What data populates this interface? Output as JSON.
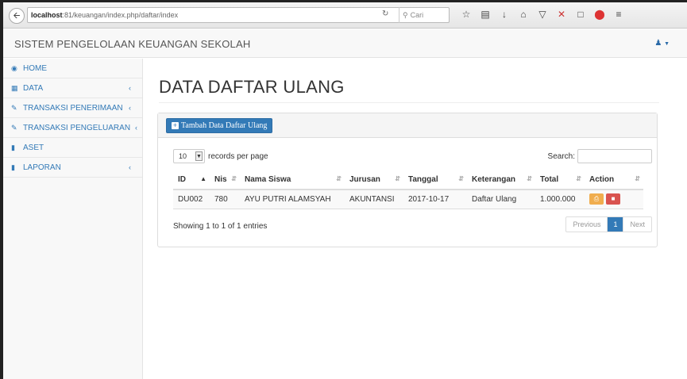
{
  "browser": {
    "url_host": "localhost",
    "url_rest": ":81/keuangan/index.php/daftar/index",
    "search_placeholder": "Cari",
    "reload_icon": "reload-icon",
    "icons": [
      "star-icon",
      "library-icon",
      "download-icon",
      "home-icon",
      "pocket-icon",
      "x-icon",
      "extension-icon",
      "adblock-icon",
      "menu-icon"
    ]
  },
  "header": {
    "title": "SISTEM PENGELOLAAN KEUANGAN SEKOLAH",
    "user_icon": "user-icon"
  },
  "sidebar": {
    "items": [
      {
        "label": "HOME",
        "icon": "dashboard-icon",
        "has_arrow": false
      },
      {
        "label": "DATA",
        "icon": "table-icon",
        "has_arrow": true
      },
      {
        "label": "TRANSAKSI PENERIMAAN",
        "icon": "edit-icon",
        "has_arrow": true
      },
      {
        "label": "TRANSAKSI PENGELUARAN",
        "icon": "edit-icon",
        "has_arrow": true
      },
      {
        "label": "ASET",
        "icon": "book-icon",
        "has_arrow": false
      },
      {
        "label": "LAPORAN",
        "icon": "book-icon",
        "has_arrow": true
      }
    ]
  },
  "main": {
    "page_title": "DATA DAFTAR ULANG",
    "add_button": "Tambah Data Daftar Ulang",
    "length_value": "10",
    "length_label": "records per page",
    "search_label": "Search:",
    "columns": [
      "ID",
      "Nis",
      "Nama Siswa",
      "Jurusan",
      "Tanggal",
      "Keterangan",
      "Total",
      "Action"
    ],
    "rows": [
      {
        "id": "DU002",
        "nis": "780",
        "nama": "AYU PUTRI ALAMSYAH",
        "jurusan": "AKUNTANSI",
        "tanggal": "2017-10-17",
        "keterangan": "Daftar Ulang",
        "total": "1.000.000"
      }
    ],
    "info": "Showing 1 to 1 of 1 entries",
    "pager": {
      "previous": "Previous",
      "current": "1",
      "next": "Next"
    }
  }
}
